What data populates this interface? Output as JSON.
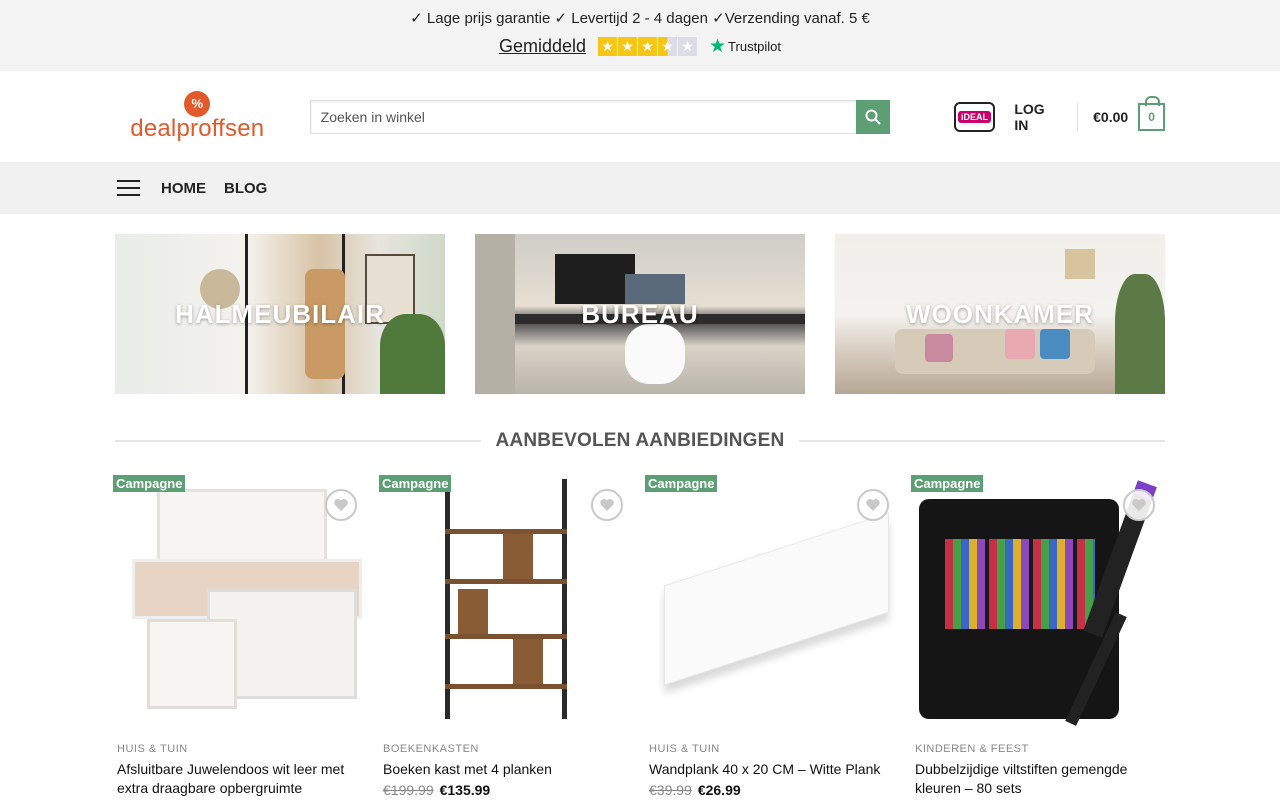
{
  "topbar": {
    "usp": "✓ Lage prijs garantie ✓ Levertijd 2 - 4 dagen ✓Verzending vanaf. 5 €",
    "rating_label": "Gemiddeld",
    "rating_stars": 3.5,
    "trustpilot": "Trustpilot"
  },
  "header": {
    "logo": "dealproffsen",
    "search_placeholder": "Zoeken in winkel",
    "ideal": "iDEAL",
    "login": "LOG IN",
    "cart_total": "€0.00",
    "cart_count": "0"
  },
  "nav": {
    "items": [
      "HOME",
      "BLOG"
    ]
  },
  "categories": [
    {
      "title": "HALMEUBILAIR"
    },
    {
      "title": "BUREAU"
    },
    {
      "title": "WOONKAMER"
    }
  ],
  "section": {
    "title": "AANBEVOLEN AANBIEDINGEN"
  },
  "products": [
    {
      "badge": "Campagne",
      "category": "HUIS & TUIN",
      "name": "Afsluitbare Juwelendoos wit leer met extra draagbare opbergruimte",
      "old_price": "",
      "price": ""
    },
    {
      "badge": "Campagne",
      "category": "BOEKENKASTEN",
      "name": "Boeken kast met 4 planken",
      "old_price": "€199.99",
      "price": "€135.99"
    },
    {
      "badge": "Campagne",
      "category": "HUIS & TUIN",
      "name": "Wandplank 40 x 20 CM – Witte Plank",
      "old_price": "€39.99",
      "price": "€26.99"
    },
    {
      "badge": "Campagne",
      "category": "KINDEREN & FEEST",
      "name": "Dubbelzijdige viltstiften gemengde kleuren – 80 sets",
      "old_price": "",
      "price": ""
    }
  ],
  "colors": {
    "accent": "#5e9e74",
    "brand": "#e05a2b"
  }
}
